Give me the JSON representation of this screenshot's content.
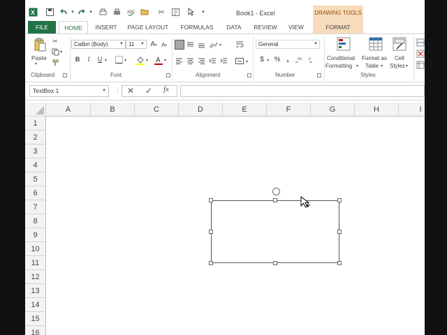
{
  "titlebar": {
    "title": "Book1 - Excel",
    "contextual_group": "DRAWING TOOLS"
  },
  "tabs": {
    "file": "FILE",
    "home": "HOME",
    "insert": "INSERT",
    "page_layout": "PAGE LAYOUT",
    "formulas": "FORMULAS",
    "data": "DATA",
    "review": "REVIEW",
    "view": "VIEW",
    "format": "FORMAT"
  },
  "ribbon": {
    "clipboard": {
      "label": "Clipboard",
      "paste": "Paste"
    },
    "font": {
      "label": "Font",
      "font_name": "Calibri (Body)",
      "font_size": "11",
      "bold": "B",
      "italic": "I",
      "underline": "U"
    },
    "alignment": {
      "label": "Alignment"
    },
    "number": {
      "label": "Number",
      "format": "General",
      "currency": "$",
      "percent": "%",
      "comma": ","
    },
    "styles": {
      "label": "Styles",
      "conditional_line1": "Conditional",
      "conditional_line2": "Formatting",
      "format_table_line1": "Format as",
      "format_table_line2": "Table",
      "cell_styles_line1": "Cell",
      "cell_styles_line2": "Styles"
    }
  },
  "formula_bar": {
    "name_box": "TextBox 1",
    "cancel": "✕",
    "enter": "✓",
    "fx": "fx",
    "value": ""
  },
  "grid": {
    "columns": [
      "A",
      "B",
      "C",
      "D",
      "E",
      "F",
      "G",
      "H",
      "I"
    ],
    "rows": [
      "1",
      "2",
      "3",
      "4",
      "5",
      "6",
      "7",
      "8",
      "9",
      "10",
      "11",
      "12",
      "13",
      "14",
      "15",
      "16"
    ]
  },
  "colors": {
    "excel_green": "#217346",
    "drawing_tools_bg": "#f7dcbc",
    "font_color_red": "#c00000",
    "fill_yellow": "#ffff00"
  }
}
